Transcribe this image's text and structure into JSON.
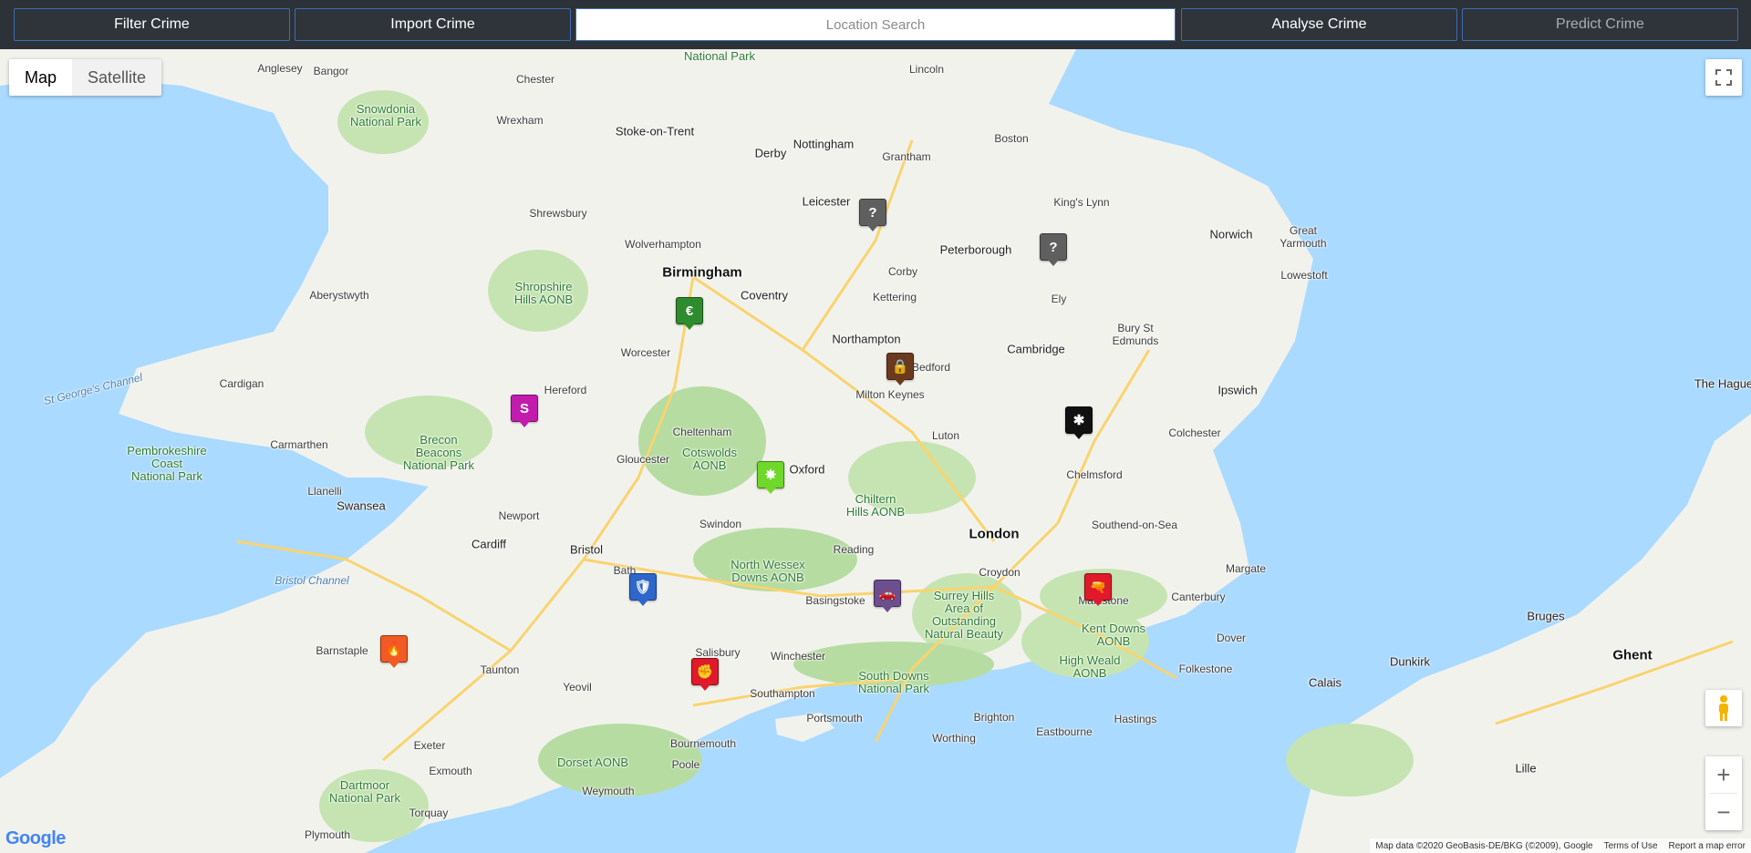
{
  "toolbar": {
    "filter_label": "Filter Crime",
    "import_label": "Import Crime",
    "search_placeholder": "Location Search",
    "analyse_label": "Analyse Crime",
    "predict_label": "Predict Crime"
  },
  "map_type": {
    "map": "Map",
    "satellite": "Satellite"
  },
  "colors": {
    "sea": "#aadaff",
    "land": "#f2f2ed",
    "park": "#b6dca2",
    "motorway": "#f9d46e",
    "accent_border": "#3b6db0"
  },
  "labels": {
    "birmingham": "Birmingham",
    "london": "London",
    "stoke": "Stoke-on-Trent",
    "derby": "Derby",
    "nottingham": "Nottingham",
    "leicester": "Leicester",
    "coventry": "Coventry",
    "northampton": "Northampton",
    "oxford": "Oxford",
    "bristol": "Bristol",
    "cardiff": "Cardiff",
    "swansea": "Swansea",
    "cambridge": "Cambridge",
    "ipswich": "Ipswich",
    "norwich": "Norwich",
    "peterborough": "Peterborough",
    "chester": "Chester",
    "wrexham": "Wrexham",
    "shrewsbury": "Shrewsbury",
    "wolverhampton": "Wolverhampton",
    "worcester": "Worcester",
    "hereford": "Hereford",
    "gloucester": "Gloucester",
    "cheltenham": "Cheltenham",
    "swindon": "Swindon",
    "reading": "Reading",
    "luton": "Luton",
    "bedford": "Bedford",
    "milton_keynes": "Milton Keynes",
    "chelmsford": "Chelmsford",
    "colchester": "Colchester",
    "southend": "Southend-on-Sea",
    "maidstone": "Maidstone",
    "canterbury": "Canterbury",
    "dover": "Dover",
    "folkestone": "Folkestone",
    "brighton": "Brighton",
    "eastbourne": "Eastbourne",
    "hastings": "Hastings",
    "worthing": "Worthing",
    "portsmouth": "Portsmouth",
    "southampton": "Southampton",
    "bournemouth": "Bournemouth",
    "poole": "Poole",
    "weymouth": "Weymouth",
    "salisbury": "Salisbury",
    "winchester": "Winchester",
    "basingstoke": "Basingstoke",
    "bath": "Bath",
    "taunton": "Taunton",
    "yeovil": "Yeovil",
    "exeter": "Exeter",
    "exmouth": "Exmouth",
    "torquay": "Torquay",
    "plymouth": "Plymouth",
    "barnstaple": "Barnstaple",
    "croydon": "Croydon",
    "lincoln": "Lincoln",
    "boston": "Boston",
    "grantham": "Grantham",
    "corby": "Corby",
    "kettering": "Kettering",
    "ely": "Ely",
    "bury": "Bury St\nEdmunds",
    "lowestoft": "Lowestoft",
    "great_yarmouth": "Great\nYarmouth",
    "kings_lynn": "King's Lynn",
    "margate": "Margate",
    "calais": "Calais",
    "dunkirk": "Dunkirk",
    "ghent": "Ghent",
    "bruges": "Bruges",
    "lille": "Lille",
    "the_hague": "The Hague",
    "newport": "Newport",
    "llanelli": "Llanelli",
    "aberystwyth": "Aberystwyth",
    "carmarthen": "Carmarthen",
    "cardigan": "Cardigan",
    "bangor": "Bangor",
    "anglesey": "Anglesey",
    "snowdonia": "Snowdonia\nNational Park",
    "brecon": "Brecon\nBeacons\nNational Park",
    "pembrokeshire": "Pembrokeshire\nCoast\nNational Park",
    "shropshire": "Shropshire\nHills AONB",
    "cotswolds": "Cotswolds\nAONB",
    "chiltern": "Chiltern\nHills AONB",
    "north_wessex": "North Wessex\nDowns AONB",
    "surrey_hills": "Surrey Hills\nArea of\nOutstanding\nNatural Beauty",
    "south_downs": "South Downs\nNational Park",
    "high_weald": "High Weald\nAONB",
    "kent_downs": "Kent Downs\nAONB",
    "dorset": "Dorset AONB",
    "dartmoor": "Dartmoor\nNational Park",
    "national_park_top": "National Park",
    "st_georges": "St George's Channel",
    "bristol_channel": "Bristol Channel"
  },
  "markers": [
    {
      "name": "unknown-crime-marker",
      "glyph": "?",
      "color": "#5f5f5f"
    },
    {
      "name": "unknown-crime-marker",
      "glyph": "?",
      "color": "#5f5f5f"
    },
    {
      "name": "robbery-marker",
      "glyph": "€",
      "color": "#2e8b2e"
    },
    {
      "name": "burglary-marker",
      "glyph": "🔒",
      "color": "#6b3a1e"
    },
    {
      "name": "shoplifting-marker",
      "glyph": "S",
      "color": "#c21cae"
    },
    {
      "name": "weapons-marker",
      "glyph": "✱",
      "color": "#111111"
    },
    {
      "name": "drugs-marker",
      "glyph": "✸",
      "color": "#6fd82a"
    },
    {
      "name": "asb-marker",
      "glyph": "🛡",
      "color": "#2e67c9"
    },
    {
      "name": "vehicle-crime-marker",
      "glyph": "🚗",
      "color": "#6b4f8f"
    },
    {
      "name": "violent-crime-marker",
      "glyph": "🔫",
      "color": "#e0192b"
    },
    {
      "name": "arson-marker",
      "glyph": "🔥",
      "color": "#f15a24"
    },
    {
      "name": "public-order-marker",
      "glyph": "✊",
      "color": "#e0192b"
    }
  ],
  "footer": {
    "attribution": "Map data ©2020 GeoBasis-DE/BKG (©2009), Google",
    "terms": "Terms of Use",
    "report": "Report a map error"
  },
  "google": "Google"
}
